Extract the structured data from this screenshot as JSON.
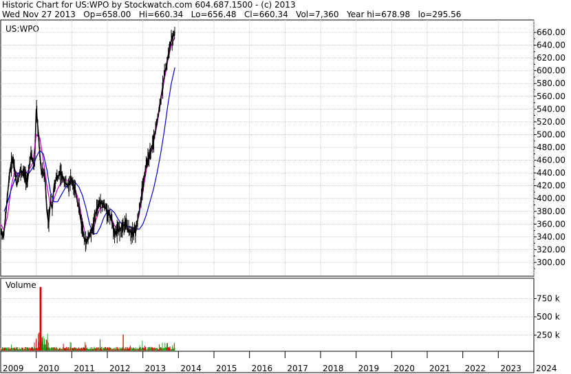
{
  "header": {
    "line1": "Historic Chart for US:WPO by Stockwatch.com 604.687.1500 - (c) 2013",
    "line2": "Wed Nov 27 2013   Op=658.00   Hi=660.34   Lo=656.48   Cl=660.34   Vol=7,360   Year hi=678.98   lo=295.56"
  },
  "chart_data": {
    "type": "line",
    "title": "US:WPO",
    "price_panel": {
      "ylim": [
        280,
        680
      ],
      "ticks": [
        "660.00",
        "640.00",
        "620.00",
        "600.00",
        "580.00",
        "560.00",
        "540.00",
        "520.00",
        "500.00",
        "480.00",
        "460.00",
        "440.00",
        "420.00",
        "400.00",
        "380.00",
        "360.00",
        "340.00",
        "320.00",
        "300.00"
      ],
      "series": [
        {
          "color": "#000000",
          "x": [
            2009.0,
            2009.08,
            2009.15,
            2009.25,
            2009.35,
            2009.45,
            2009.55,
            2009.65,
            2009.75,
            2009.85,
            2009.95,
            2010.0,
            2010.05,
            2010.1,
            2010.15,
            2010.2,
            2010.25,
            2010.3,
            2010.35,
            2010.4,
            2010.45,
            2010.5,
            2010.6,
            2010.7,
            2010.8,
            2010.9,
            2011.0,
            2011.1,
            2011.2,
            2011.3,
            2011.4,
            2011.5,
            2011.6,
            2011.7,
            2011.8,
            2011.9,
            2012.0,
            2012.1,
            2012.2,
            2012.3,
            2012.4,
            2012.5,
            2012.6,
            2012.7,
            2012.8,
            2012.9,
            2013.0,
            2013.1,
            2013.2,
            2013.3,
            2013.4,
            2013.5,
            2013.6,
            2013.7,
            2013.8,
            2013.9
          ],
          "values": [
            350,
            340,
            380,
            440,
            465,
            420,
            445,
            440,
            425,
            470,
            450,
            540,
            510,
            470,
            440,
            440,
            430,
            380,
            360,
            395,
            385,
            420,
            435,
            440,
            425,
            420,
            430,
            410,
            385,
            350,
            330,
            345,
            355,
            385,
            395,
            390,
            380,
            370,
            345,
            350,
            355,
            360,
            350,
            345,
            350,
            380,
            420,
            455,
            470,
            490,
            520,
            555,
            590,
            620,
            648,
            660
          ]
        },
        {
          "color": "#cc00cc",
          "x": [
            2009.0,
            2009.1,
            2009.2,
            2009.3,
            2009.4,
            2009.5,
            2009.6,
            2009.7,
            2009.8,
            2009.9,
            2010.0,
            2010.1,
            2010.2,
            2010.3,
            2010.4,
            2010.5,
            2010.6,
            2010.7,
            2010.8,
            2010.9,
            2011.0,
            2011.1,
            2011.2,
            2011.3,
            2011.4,
            2011.5,
            2011.6,
            2011.7,
            2011.8,
            2011.9,
            2012.0,
            2012.1,
            2012.2,
            2012.3,
            2012.4,
            2012.5,
            2012.6,
            2012.7,
            2012.8,
            2012.9,
            2013.0,
            2013.1,
            2013.2,
            2013.3,
            2013.4,
            2013.5,
            2013.6,
            2013.7,
            2013.8,
            2013.9
          ],
          "values": [
            360,
            350,
            375,
            420,
            445,
            435,
            440,
            440,
            445,
            455,
            500,
            495,
            460,
            420,
            390,
            400,
            415,
            425,
            430,
            428,
            425,
            415,
            395,
            365,
            340,
            340,
            350,
            370,
            385,
            388,
            382,
            372,
            358,
            352,
            355,
            358,
            352,
            350,
            355,
            375,
            410,
            445,
            465,
            488,
            515,
            550,
            585,
            615,
            640,
            652
          ]
        },
        {
          "color": "#0000cc",
          "x": [
            2009.1,
            2009.2,
            2009.3,
            2009.4,
            2009.5,
            2009.6,
            2009.7,
            2009.8,
            2009.9,
            2010.0,
            2010.1,
            2010.2,
            2010.3,
            2010.4,
            2010.5,
            2010.6,
            2010.7,
            2010.8,
            2010.9,
            2011.0,
            2011.1,
            2011.2,
            2011.3,
            2011.4,
            2011.5,
            2011.6,
            2011.7,
            2011.8,
            2011.9,
            2012.0,
            2012.1,
            2012.2,
            2012.3,
            2012.4,
            2012.5,
            2012.6,
            2012.7,
            2012.8,
            2012.9,
            2013.0,
            2013.1,
            2013.2,
            2013.3,
            2013.4,
            2013.5,
            2013.6,
            2013.7,
            2013.8,
            2013.9
          ],
          "values": [
            380,
            395,
            415,
            430,
            440,
            443,
            440,
            440,
            448,
            465,
            475,
            470,
            445,
            410,
            395,
            395,
            405,
            415,
            423,
            428,
            425,
            418,
            405,
            385,
            360,
            345,
            345,
            355,
            370,
            380,
            383,
            378,
            368,
            360,
            358,
            356,
            354,
            352,
            352,
            360,
            375,
            395,
            415,
            440,
            470,
            505,
            545,
            580,
            605
          ]
        }
      ]
    },
    "volume_panel": {
      "label": "Volume",
      "ylim": [
        0,
        1000000
      ],
      "ticks": [
        "750 k",
        "500 k",
        "250 k"
      ]
    },
    "x_axis": {
      "ticks": [
        "2009",
        "2010",
        "2011",
        "2012",
        "2013",
        "2014",
        "2015",
        "2016",
        "2017",
        "2018",
        "2019",
        "2020",
        "2021",
        "2022",
        "2023",
        "2024"
      ],
      "range": [
        2009.0,
        2024.0
      ]
    }
  }
}
